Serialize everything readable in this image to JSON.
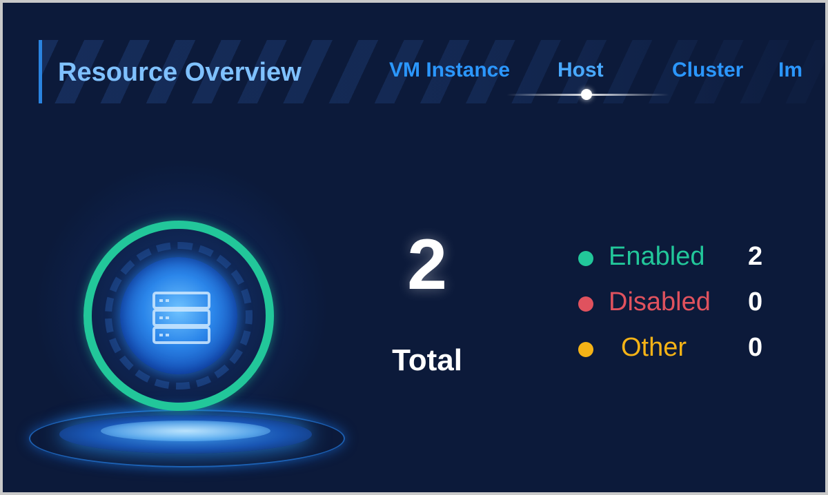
{
  "header": {
    "title": "Resource Overview",
    "tabs": [
      {
        "id": "vm",
        "label": "VM Instance"
      },
      {
        "id": "host",
        "label": "Host",
        "active": true
      },
      {
        "id": "cluster",
        "label": "Cluster"
      },
      {
        "id": "im",
        "label": "Im"
      }
    ]
  },
  "summary": {
    "total_value": "2",
    "total_label": "Total"
  },
  "legend": [
    {
      "label": "Enabled",
      "value": "2",
      "color": "#22c79a"
    },
    {
      "label": "Disabled",
      "value": "0",
      "color": "#e0525e"
    },
    {
      "label": "Other",
      "value": "0",
      "color": "#f5b316"
    }
  ],
  "illustration": {
    "icon": "server-icon",
    "ring_color": "#22c79a"
  }
}
